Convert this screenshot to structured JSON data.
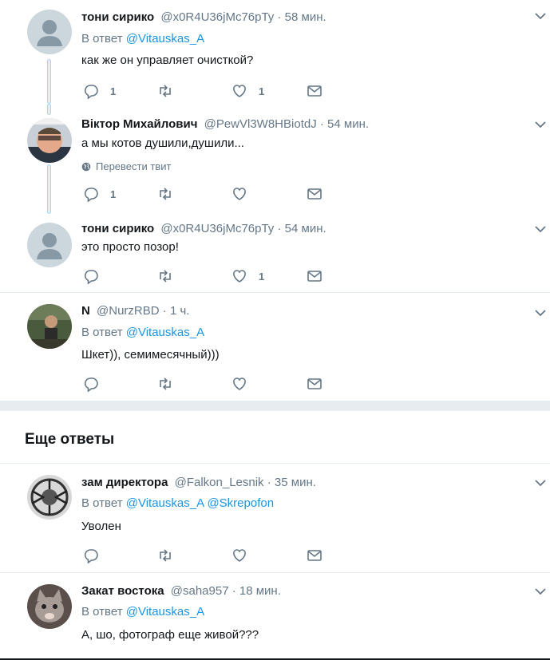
{
  "reply_prefix": "В ответ",
  "translate_label": "Перевести твит",
  "more_replies_title": "Еще ответы",
  "tweets": [
    {
      "name": "тони сирико",
      "handle": "@x0R4U36jMc76pTy",
      "dot": "·",
      "time": "58 мин.",
      "reply_to": "@Vitauskas_A",
      "text": "как же он управляет очисткой?",
      "reply_count": "1",
      "retweet_count": "",
      "like_count": "1"
    },
    {
      "name": "Віктор Михайлович",
      "handle": "@PewVl3W8HBiotdJ",
      "dot": "·",
      "time": "54 мин.",
      "text": "а мы котов душили,душили...",
      "reply_count": "1",
      "retweet_count": "",
      "like_count": ""
    },
    {
      "name": "тони сирико",
      "handle": "@x0R4U36jMc76pTy",
      "dot": "·",
      "time": "54 мин.",
      "text": "это просто позор!",
      "reply_count": "",
      "retweet_count": "",
      "like_count": "1"
    },
    {
      "name": "N",
      "handle": "@NurzRBD",
      "dot": "·",
      "time": "1 ч.",
      "reply_to": "@Vitauskas_A",
      "text": "Шкет)), семимесячный)))",
      "reply_count": "",
      "retweet_count": "",
      "like_count": ""
    },
    {
      "name": "зам директора",
      "handle": "@Falkon_Lesnik",
      "dot": "·",
      "time": "35 мин.",
      "reply_to": "@Vitauskas_A",
      "reply_to_2": "@Skrepofon",
      "text": "Уволен",
      "reply_count": "",
      "retweet_count": "",
      "like_count": ""
    },
    {
      "name": "Закат востока",
      "handle": "@saha957",
      "dot": "·",
      "time": "18 мин.",
      "reply_to": "@Vitauskas_A",
      "text": "А, шо, фотограф еще живой???"
    }
  ],
  "colors": {
    "link": "#1b95e0",
    "muted": "#657786",
    "text": "#14171a",
    "border": "#e6ecf0"
  }
}
